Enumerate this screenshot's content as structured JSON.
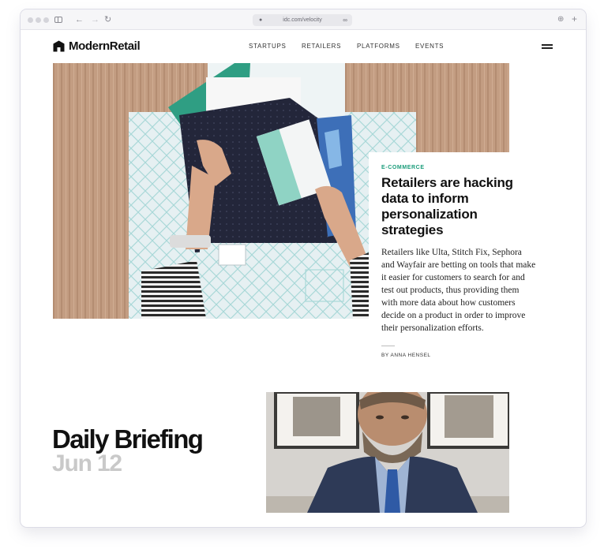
{
  "browser": {
    "url": "idc.com/velocity"
  },
  "site": {
    "logo_text": "ModernRetail",
    "nav": [
      "STARTUPS",
      "RETAILERS",
      "PLATFORMS",
      "EVENTS"
    ]
  },
  "hero": {
    "category": "E-COMMERCE",
    "headline": "Retailers are hacking data to inform personalization strategies",
    "summary": "Retailers like Ulta, Stitch Fix, Sephora and Wayfair are betting on tools that make it easier for customers to search for and test out products, thus providing them with more data about how customers decide on a product in order to improve their personalization efforts.",
    "byline": "BY ANNA HENSEL",
    "accent_color": "#1a9c7a"
  },
  "briefing": {
    "title": "Daily Briefing",
    "date": "Jun 12"
  },
  "icons": [
    "sidebar-icon",
    "back-icon",
    "forward-icon",
    "reload-icon",
    "lock-icon",
    "link-icon",
    "download-icon",
    "new-tab-icon",
    "logo-icon",
    "menu-icon"
  ]
}
